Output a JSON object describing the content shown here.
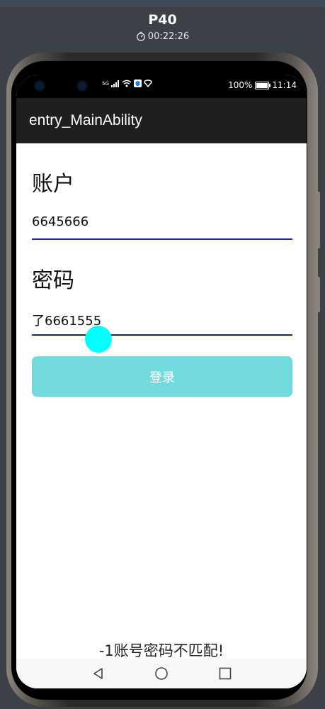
{
  "device": {
    "name": "P40",
    "timer": "00:22:26"
  },
  "status_bar": {
    "network": "5G",
    "battery": "100%",
    "time": "11:14"
  },
  "app": {
    "title": "entry_MainAbility"
  },
  "form": {
    "account_label": "账户",
    "account_value": "6645666",
    "password_label": "密码",
    "password_value": "了6661555",
    "login_label": "登录"
  },
  "toast": {
    "message": "-1账号密码不匹配!"
  },
  "colors": {
    "accent_underline": "#1a1aa8",
    "login_button": "#72dadd",
    "cursor_thumb": "#00ffff",
    "app_bar": "#1f1f1f"
  },
  "nav_icons": [
    "back-icon",
    "home-icon",
    "recents-icon"
  ]
}
